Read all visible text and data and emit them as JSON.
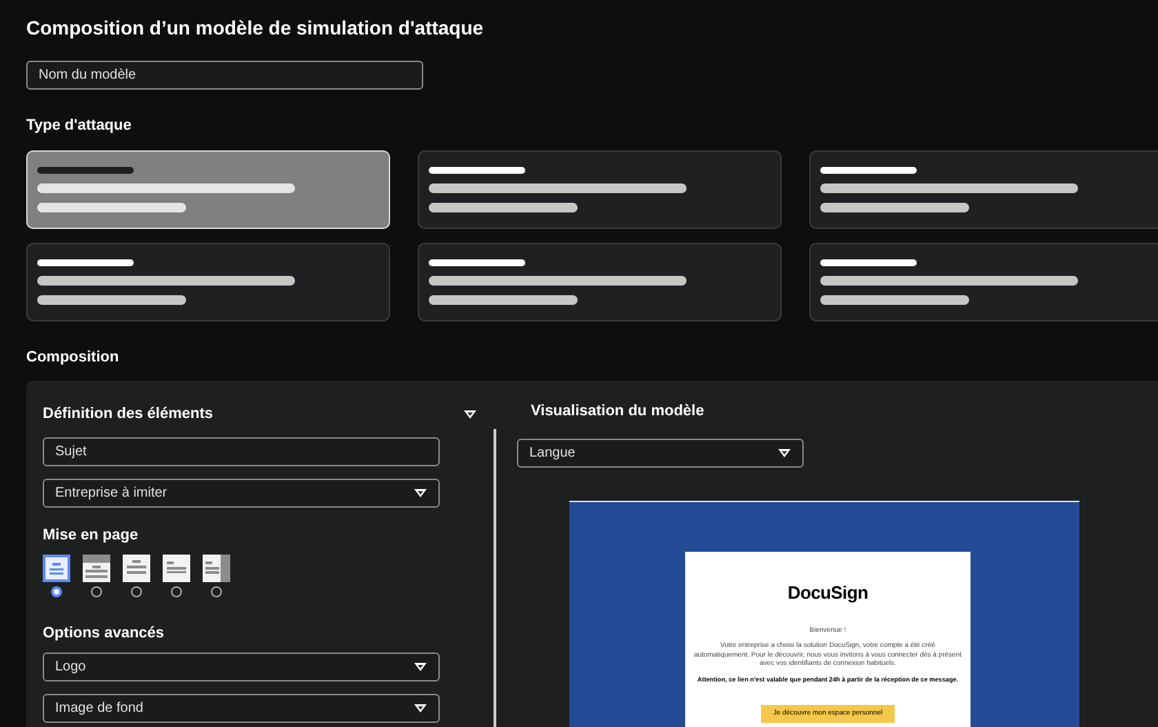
{
  "title": "Composition d’un modèle de simulation d'attaque",
  "model_name": {
    "placeholder": "Nom du modèle"
  },
  "attack_type": {
    "heading": "Type d'attaque",
    "cards": [
      {
        "selected": true
      },
      {
        "selected": false
      },
      {
        "selected": false
      },
      {
        "selected": false
      },
      {
        "selected": false
      },
      {
        "selected": false
      }
    ]
  },
  "composition": {
    "heading": "Composition",
    "definition": {
      "heading": "Définition des éléments",
      "expanded": true,
      "subject": {
        "placeholder": "Sujet"
      },
      "company": {
        "placeholder": "Entreprise à imiter"
      }
    },
    "layout": {
      "heading": "Mise en page",
      "options": [
        {
          "kind": "centered",
          "selected": true
        },
        {
          "kind": "banner",
          "selected": false
        },
        {
          "kind": "stacked",
          "selected": false
        },
        {
          "kind": "left",
          "selected": false
        },
        {
          "kind": "sidebar",
          "selected": false
        }
      ]
    },
    "advanced": {
      "heading": "Options avancés",
      "selects": [
        {
          "placeholder": "Logo"
        },
        {
          "placeholder": "Image de fond"
        }
      ]
    },
    "preview": {
      "heading": "Visualisation du modèle",
      "language": {
        "placeholder": "Langue"
      },
      "email": {
        "brand": "DocuSign",
        "greeting": "Bienvenue !",
        "body": "Votre entreprise a choisi la solution DocuSign, votre compte a été créé automatiquement. Pour le découvrir, nous vous invitons à vous connecter dès à présent avec vos identifiants de connexion habituels.",
        "warning": "Attention, ce lien n'est valable que pendant 24h à partir de la réception de ce message.",
        "button": "Je découvre mon espace personnel"
      }
    }
  }
}
